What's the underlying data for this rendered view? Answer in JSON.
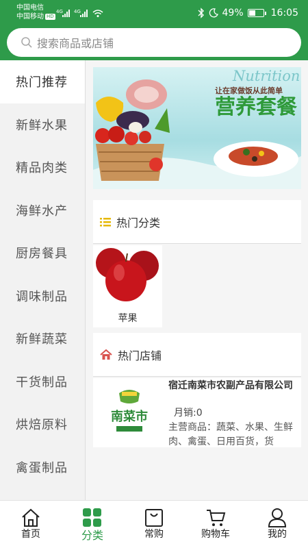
{
  "status_bar": {
    "carrier_1": "中国电信",
    "carrier_2": "中国移动",
    "hd_badge": "HD",
    "signal_1": "4G",
    "signal_2": "4G",
    "battery_text": "49%",
    "battery_level": 0.49,
    "time": "16:05"
  },
  "search": {
    "placeholder": "搜索商品或店铺"
  },
  "categories": [
    {
      "label": "热门推荐",
      "active": true
    },
    {
      "label": "新鲜水果"
    },
    {
      "label": "精品肉类"
    },
    {
      "label": "海鲜水产"
    },
    {
      "label": "厨房餐具"
    },
    {
      "label": "调味制品"
    },
    {
      "label": "新鲜蔬菜"
    },
    {
      "label": "干货制品"
    },
    {
      "label": "烘焙原料"
    },
    {
      "label": "禽蛋制品"
    }
  ],
  "banner": {
    "word": "Nutrition",
    "slogan": "让在家做饭从此简单",
    "headline": "营养套餐"
  },
  "hot_categories": {
    "title": "热门分类",
    "items": [
      {
        "name": "苹果"
      }
    ]
  },
  "hot_stores": {
    "title": "热门店铺",
    "stores": [
      {
        "name": "宿迁南菜市农副产品有限公司",
        "sales": "月销:0",
        "description": "主营商品：蔬菜、水果、生鲜肉、禽蛋、日用百货，货",
        "logo_text": "南菜市"
      }
    ]
  },
  "bottom_nav": {
    "items": [
      {
        "label": "首页",
        "icon": "home-icon"
      },
      {
        "label": "分类",
        "icon": "category-icon",
        "active": true
      },
      {
        "label": "常购",
        "icon": "bag-icon"
      },
      {
        "label": "购物车",
        "icon": "cart-icon"
      },
      {
        "label": "我的",
        "icon": "user-icon"
      }
    ]
  },
  "colors": {
    "brand_green": "#2e9b4a",
    "list_icon_yellow": "#e6b800",
    "home_icon_red": "#d9534f"
  }
}
